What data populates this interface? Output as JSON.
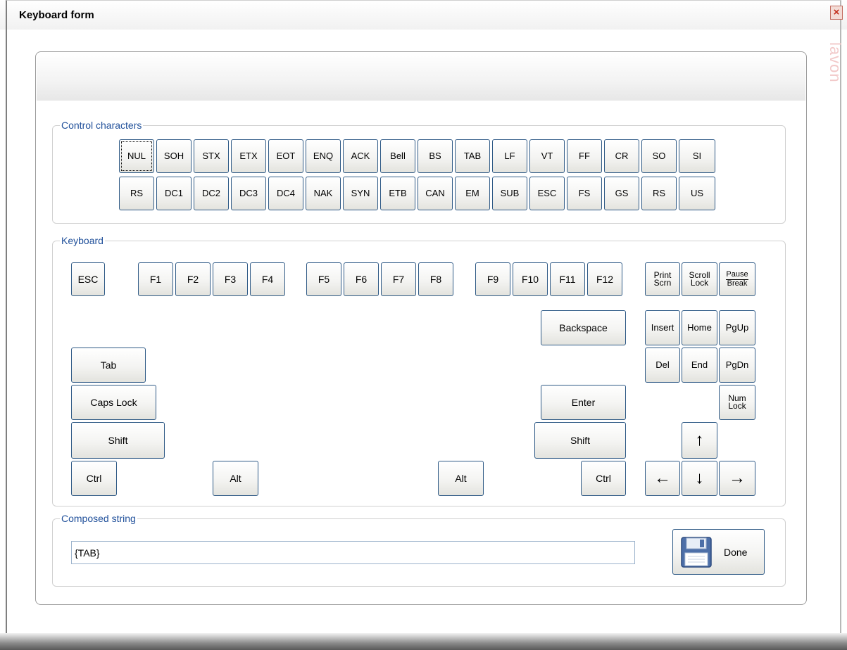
{
  "window": {
    "title": "Keyboard form",
    "close_label": "×",
    "watermark": "lavon"
  },
  "groups": {
    "control": "Control characters",
    "keyboard": "Keyboard",
    "composed": "Composed string"
  },
  "control_row1": [
    "NUL",
    "SOH",
    "STX",
    "ETX",
    "EOT",
    "ENQ",
    "ACK",
    "Bell",
    "BS",
    "TAB",
    "LF",
    "VT",
    "FF",
    "CR",
    "SO",
    "SI"
  ],
  "control_row2": [
    "RS",
    "DC1",
    "DC2",
    "DC3",
    "DC4",
    "NAK",
    "SYN",
    "ETB",
    "CAN",
    "EM",
    "SUB",
    "ESC",
    "FS",
    "GS",
    "RS",
    "US"
  ],
  "keys": {
    "esc": "ESC",
    "f1": "F1",
    "f2": "F2",
    "f3": "F3",
    "f4": "F4",
    "f5": "F5",
    "f6": "F6",
    "f7": "F7",
    "f8": "F8",
    "f9": "F9",
    "f10": "F10",
    "f11": "F11",
    "f12": "F12",
    "print_screen": "Print\nScrn",
    "scroll_lock": "Scroll\nLock",
    "pause_top": "Pause",
    "pause_bottom": "Break",
    "backspace": "Backspace",
    "insert": "Insert",
    "home": "Home",
    "pgup": "PgUp",
    "del": "Del",
    "end": "End",
    "pgdn": "PgDn",
    "num_lock": "Num\nLock",
    "tab": "Tab",
    "caps_lock": "Caps Lock",
    "shift_left": "Shift",
    "shift_right": "Shift",
    "enter": "Enter",
    "ctrl_left": "Ctrl",
    "ctrl_right": "Ctrl",
    "alt_left": "Alt",
    "alt_right": "Alt",
    "arrow_up": "↑",
    "arrow_down": "↓",
    "arrow_left": "←",
    "arrow_right": "→"
  },
  "composed": {
    "value": "{TAB}"
  },
  "done_label": "Done"
}
